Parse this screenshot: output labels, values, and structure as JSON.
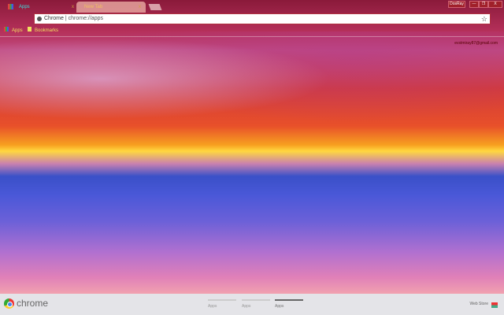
{
  "tabs": [
    {
      "label": "Apps",
      "close": "x"
    },
    {
      "label": "New Tab",
      "close": "x"
    }
  ],
  "window": {
    "profile_button": "DosRay",
    "minimize": "—",
    "restore": "❐",
    "close": "X"
  },
  "omnibox": {
    "site_label": "Chrome",
    "url": "chrome://apps",
    "bookmark_star": "☆"
  },
  "bookmarks": [
    {
      "label": "Apps"
    },
    {
      "label": "Bookmarks"
    }
  ],
  "account": {
    "email": "evstmiray87@gmail.com"
  },
  "footer": {
    "brand": "chrome",
    "pages": [
      {
        "label": "Apps",
        "active": false
      },
      {
        "label": "Apps",
        "active": false
      },
      {
        "label": "Apps",
        "active": true
      }
    ],
    "web_store": "Web Store"
  }
}
